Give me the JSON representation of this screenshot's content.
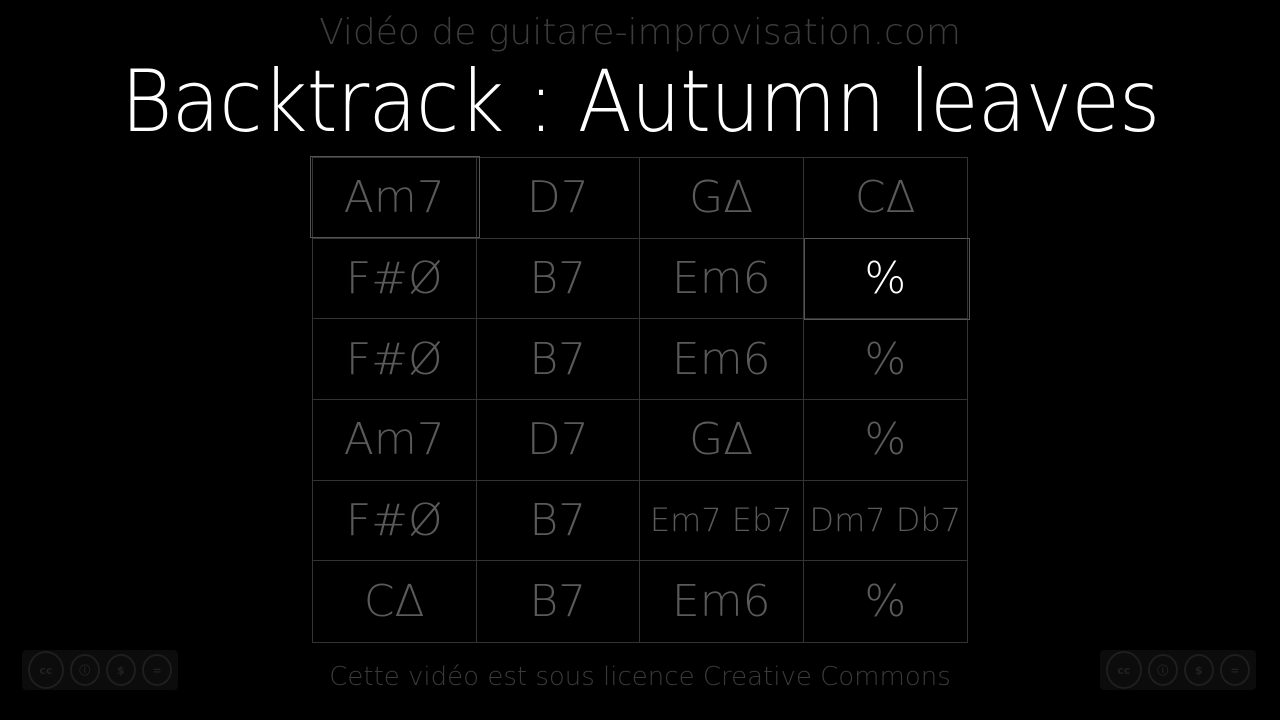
{
  "header": {
    "site": "Vidéo de guitare-improvisation.com",
    "title": "Backtrack : Autumn leaves"
  },
  "grid": {
    "rows": [
      [
        "Am7",
        "D7",
        "G∆",
        "C∆"
      ],
      [
        "F#Ø",
        "B7",
        "Em6",
        "%"
      ],
      [
        "F#Ø",
        "B7",
        "Em6",
        "%"
      ],
      [
        "Am7",
        "D7",
        "G∆",
        "%"
      ],
      [
        "F#Ø",
        "B7",
        "Em7 Eb7",
        "Dm7 Db7"
      ],
      [
        "C∆",
        "B7",
        "Em6",
        "%"
      ]
    ],
    "active_cell": [
      1,
      3
    ]
  },
  "footer": {
    "license_text": "Cette vidéo est sous licence Creative Commons",
    "badge": {
      "cc": "cc",
      "labels": [
        "BY",
        "NC",
        "ND"
      ]
    }
  }
}
